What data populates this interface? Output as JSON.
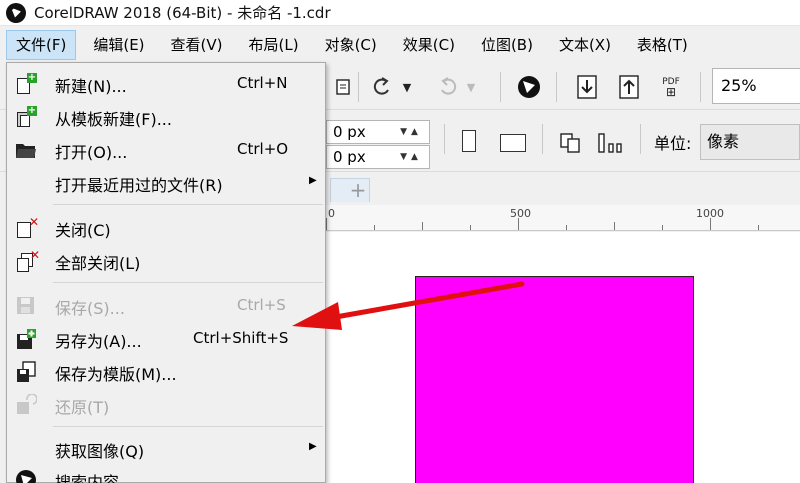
{
  "window": {
    "title": "CorelDRAW 2018 (64-Bit) - 未命名 -1.cdr"
  },
  "menubar": [
    {
      "label": "文件(F)"
    },
    {
      "label": "编辑(E)"
    },
    {
      "label": "查看(V)"
    },
    {
      "label": "布局(L)"
    },
    {
      "label": "对象(C)"
    },
    {
      "label": "效果(C)"
    },
    {
      "label": "位图(B)"
    },
    {
      "label": "文本(X)"
    },
    {
      "label": "表格(T)"
    }
  ],
  "toolbar": {
    "pdf_label": "PDF",
    "zoom_value": "25%"
  },
  "property_bar": {
    "field1_value": "0 px",
    "field2_value": "0 px",
    "unit_label": "单位:",
    "unit_value": "像素"
  },
  "ruler": {
    "labels": [
      "0",
      "500",
      "1000"
    ]
  },
  "file_menu": {
    "items": [
      {
        "label": "新建(N)...",
        "shortcut": "Ctrl+N",
        "icon": "new-document-icon"
      },
      {
        "label": "从模板新建(F)...",
        "shortcut": "",
        "icon": "new-from-template-icon"
      },
      {
        "label": "打开(O)...",
        "shortcut": "Ctrl+O",
        "icon": "open-folder-icon"
      },
      {
        "label": "打开最近用过的文件(R)",
        "shortcut": "",
        "icon": ""
      },
      {
        "label": "关闭(C)",
        "shortcut": "",
        "icon": "close-document-icon"
      },
      {
        "label": "全部关闭(L)",
        "shortcut": "",
        "icon": "close-all-icon"
      },
      {
        "label": "保存(S)...",
        "shortcut": "Ctrl+S",
        "icon": "save-icon"
      },
      {
        "label": "另存为(A)...",
        "shortcut": "Ctrl+Shift+S",
        "icon": "save-as-icon"
      },
      {
        "label": "保存为模版(M)...",
        "shortcut": "",
        "icon": "save-as-template-icon"
      },
      {
        "label": "还原(T)",
        "shortcut": "",
        "icon": "revert-icon"
      },
      {
        "label": "获取图像(Q)",
        "shortcut": "",
        "icon": ""
      },
      {
        "label": "搜索内容",
        "shortcut": "",
        "icon": "search-content-icon"
      }
    ]
  },
  "colors": {
    "rectangle_fill": "#ff00ff",
    "arrow": "#e01010",
    "menu_highlight": "#cce4f7"
  }
}
